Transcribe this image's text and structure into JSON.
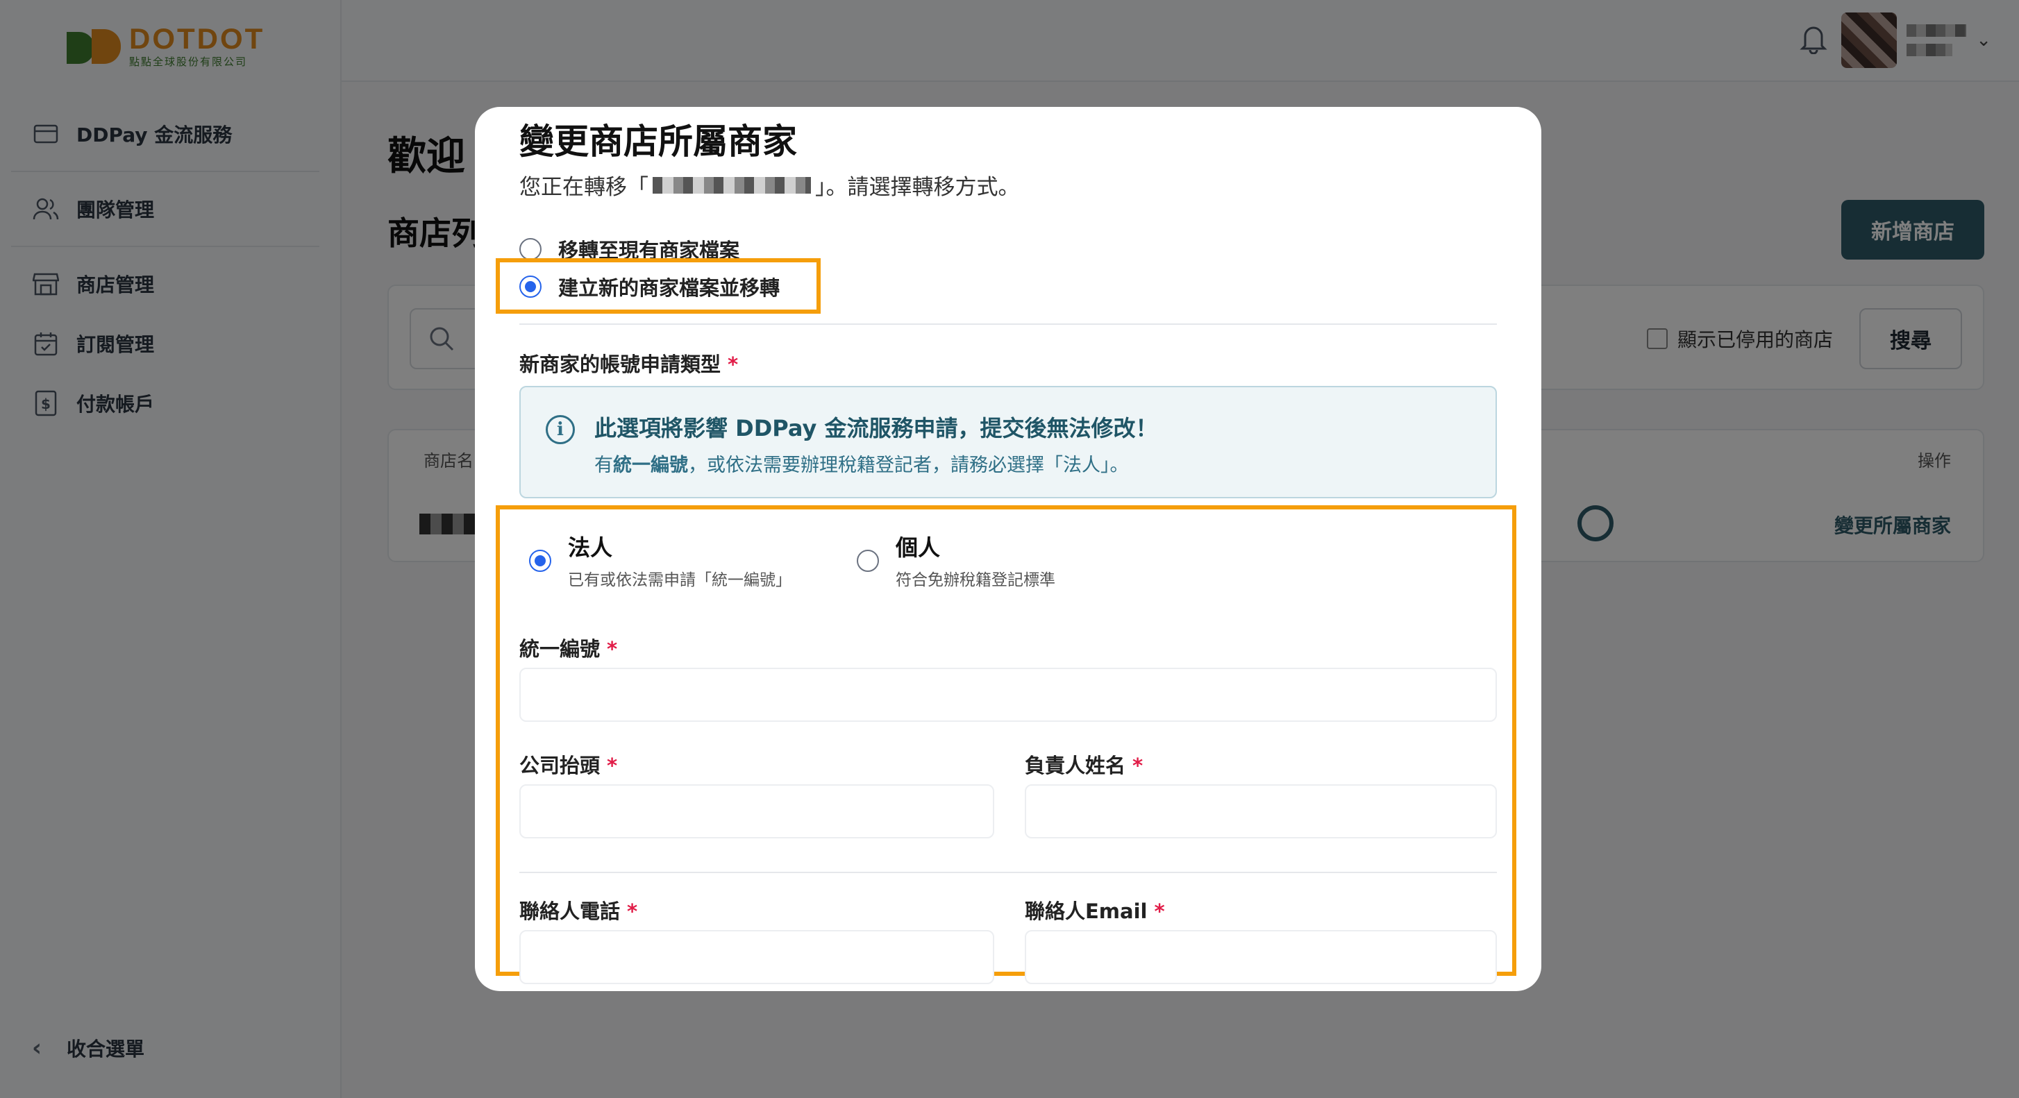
{
  "brand": {
    "name": "DOTDOT",
    "subtitle": "點點全球股份有限公司"
  },
  "sidebar": {
    "items": [
      {
        "label": "DDPay 金流服務",
        "icon": "card-icon"
      },
      {
        "label": "團隊管理",
        "icon": "team-icon"
      },
      {
        "label": "商店管理",
        "icon": "store-icon"
      },
      {
        "label": "訂閱管理",
        "icon": "calendar-icon"
      },
      {
        "label": "付款帳戶",
        "icon": "dollar-doc-icon"
      }
    ],
    "collapse_label": "收合選單"
  },
  "page": {
    "welcome": "歡迎",
    "store_list_title": "商店列",
    "add_store_button": "新增商店",
    "show_disabled_label": "顯示已停用的商店",
    "search_button": "搜尋",
    "table": {
      "col_name": "商店名",
      "col_actions": "操作",
      "row_action": "變更所屬商家"
    }
  },
  "modal": {
    "title": "變更商店所屬商家",
    "subtitle_prefix": "您正在轉移「",
    "subtitle_suffix": "」。請選擇轉移方式。",
    "transfer_options": [
      {
        "label": "移轉至現有商家檔案",
        "selected": false
      },
      {
        "label": "建立新的商家檔案並移轉",
        "selected": true
      }
    ],
    "account_type_label": "新商家的帳號申請類型",
    "required_mark": "*",
    "notice": {
      "title": "此選項將影響 DDPay 金流服務申請，提交後無法修改！",
      "desc_prefix": "有",
      "desc_bold": "統一編號",
      "desc_suffix": "，或依法需要辦理稅籍登記者，請務必選擇「法人」。"
    },
    "entity_options": [
      {
        "title": "法人",
        "desc": "已有或依法需申請「統一編號」",
        "selected": true
      },
      {
        "title": "個人",
        "desc": "符合免辦稅籍登記標準",
        "selected": false
      }
    ],
    "fields": {
      "tax_id": "統一編號",
      "company_name": "公司抬頭",
      "owner_name": "負責人姓名",
      "contact_phone": "聯絡人電話",
      "contact_email": "聯絡人Email"
    }
  },
  "colors": {
    "accent": "#2f5a68",
    "highlight": "#f59e0b",
    "radio": "#2563eb",
    "required": "#e11d48"
  }
}
